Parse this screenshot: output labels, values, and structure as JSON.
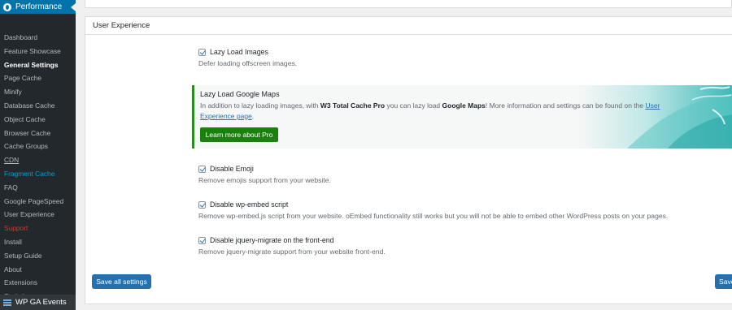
{
  "sidebar": {
    "header": "Performance",
    "items": [
      {
        "label": "Dashboard",
        "style": "normal"
      },
      {
        "label": "Feature Showcase",
        "style": "normal"
      },
      {
        "label": "General Settings",
        "style": "current"
      },
      {
        "label": "Page Cache",
        "style": "normal"
      },
      {
        "label": "Minify",
        "style": "normal"
      },
      {
        "label": "Database Cache",
        "style": "normal"
      },
      {
        "label": "Object Cache",
        "style": "normal"
      },
      {
        "label": "Browser Cache",
        "style": "normal"
      },
      {
        "label": "Cache Groups",
        "style": "normal"
      },
      {
        "label": "CDN",
        "style": "underline"
      },
      {
        "label": "Fragment Cache",
        "style": "fragment"
      },
      {
        "label": "FAQ",
        "style": "normal"
      },
      {
        "label": "Google PageSpeed",
        "style": "normal"
      },
      {
        "label": "User Experience",
        "style": "normal"
      },
      {
        "label": "Support",
        "style": "support"
      },
      {
        "label": "Install",
        "style": "normal"
      },
      {
        "label": "Setup Guide",
        "style": "normal"
      },
      {
        "label": "About",
        "style": "normal"
      },
      {
        "label": "Extensions",
        "style": "normal"
      },
      {
        "label": "Statistics",
        "style": "normal"
      }
    ],
    "bottom_item": "WP GA Events"
  },
  "panel": {
    "title": "User Experience",
    "options": {
      "lazy_load": {
        "label": "Lazy Load Images",
        "description": "Defer loading offscreen images.",
        "checked": true
      },
      "disable_emoji": {
        "label": "Disable Emoji",
        "description": "Remove emojis support from your website.",
        "checked": true
      },
      "disable_embed": {
        "label": "Disable wp-embed script",
        "description": "Remove wp-embed.js script from your website. oEmbed functionality still works but you will not be able to embed other WordPress posts on your pages.",
        "checked": true
      },
      "disable_jquery_migrate": {
        "label": "Disable jquery-migrate on the front-end",
        "description": "Remove jquery-migrate support from your website front-end.",
        "checked": true
      }
    },
    "promo": {
      "title": "Lazy Load Google Maps",
      "text_before": "In addition to lazy loading images, with ",
      "text_bold_1": "W3 Total Cache Pro",
      "text_middle": " you can lazy load ",
      "text_bold_2": "Google Maps",
      "text_after": "! More information and settings can be found on the ",
      "link_text": "User Experience page",
      "text_end": ".",
      "button": "Learn more about Pro",
      "button_color": "#19820a"
    },
    "save_button": "Save all settings",
    "save_button_right": "Save"
  },
  "colors": {
    "sidebar_bg": "#23282d",
    "accent": "#0073aa",
    "button_blue": "#2271b1"
  }
}
